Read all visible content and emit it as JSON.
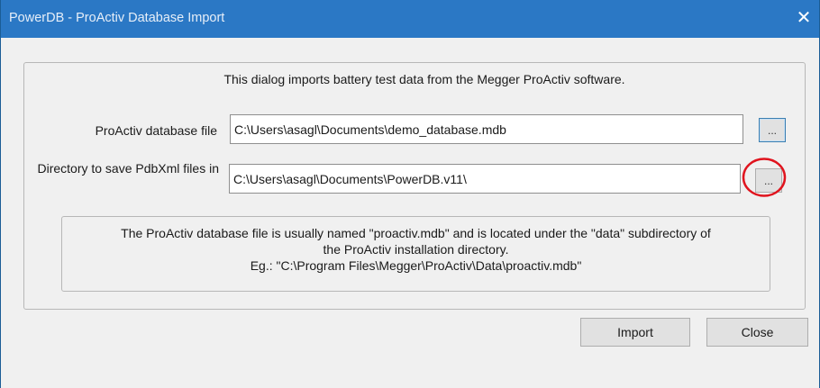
{
  "window": {
    "title": "PowerDB - ProActiv Database Import",
    "close_icon": "close-icon",
    "title_bar_color": "#2b78c5"
  },
  "dialog": {
    "intro": "This dialog imports battery test data from the Megger ProActiv software.",
    "database_file": {
      "label": "ProActiv database file",
      "value": "C:\\Users\\asagl\\Documents\\demo_database.mdb",
      "browse_label": "..."
    },
    "save_directory": {
      "label": "Directory to save PdbXml files in",
      "value": "C:\\Users\\asagl\\Documents\\PowerDB.v11\\",
      "browse_label": "...",
      "highlight_color": "#e0141e"
    },
    "note": {
      "line1": "The ProActiv database file is usually named \"proactiv.mdb\" and is located under the \"data\" subdirectory of",
      "line2": "the ProActiv installation directory.",
      "line3": "Eg.:  \"C:\\Program Files\\Megger\\ProActiv\\Data\\proactiv.mdb\""
    }
  },
  "buttons": {
    "import_label": "Import",
    "close_label": "Close"
  }
}
